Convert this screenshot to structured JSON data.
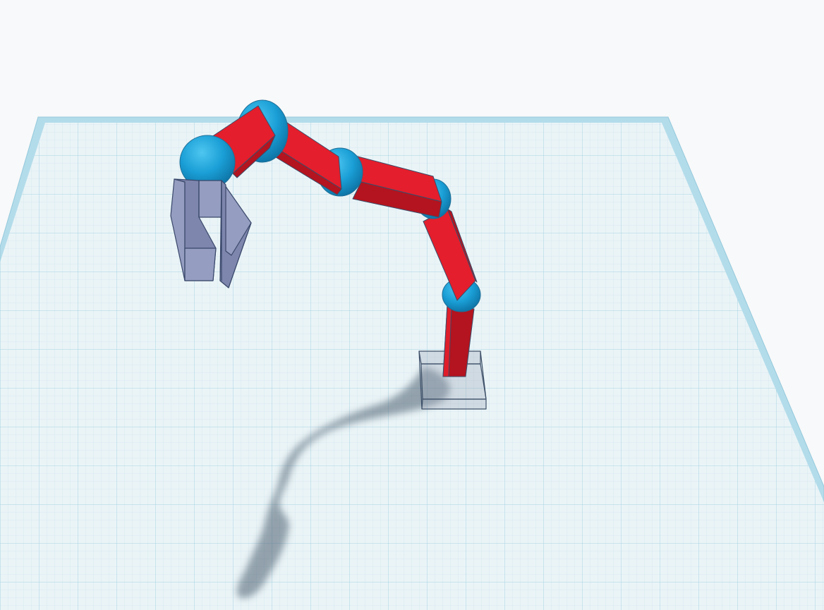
{
  "colors": {
    "background": "#f8f9fa",
    "workplane_fill": "#eaf4f7",
    "grid_minor": "#d2e6ee",
    "grid_major": "#a8d3e3",
    "workplane_border": "#b3dcea",
    "arm_segment": "#e41e2c",
    "arm_segment_shade": "#b3141f",
    "joint": "#1a9fd6",
    "gripper": "#8890b6",
    "base_hole": "#b4bcc8",
    "shadow": "#4c5e70"
  },
  "icons": {
    "workplane": "grid-workplane",
    "robot_arm": "robot-arm-model",
    "joint": "sphere-joint",
    "gripper": "claw-gripper",
    "base": "hole-box-base"
  }
}
